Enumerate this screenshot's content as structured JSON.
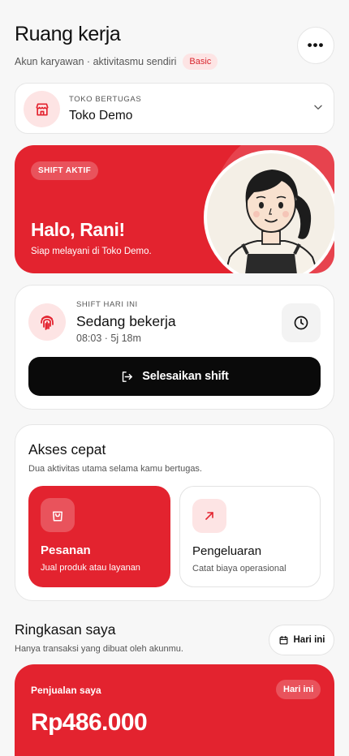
{
  "header": {
    "title": "Ruang kerja",
    "subtitle": "Akun karyawan · aktivitasmu sendiri",
    "badge": "Basic",
    "more_icon": "more-horizontal-icon"
  },
  "store": {
    "kicker": "TOKO BERTUGAS",
    "name": "Toko Demo",
    "icon": "store-icon"
  },
  "hero": {
    "badge": "SHIFT AKTIF",
    "title": "Halo, Rani!",
    "subtitle": "Siap melayani di Toko Demo."
  },
  "shift": {
    "kicker": "SHIFT HARI INI",
    "status": "Sedang bekerja",
    "time": "08:03 · 5j 18m",
    "end_button": "Selesaikan shift"
  },
  "quick_access": {
    "title": "Akses cepat",
    "subtitle": "Dua aktivitas utama selama kamu bertugas.",
    "tiles": [
      {
        "title": "Pesanan",
        "desc": "Jual produk atau layanan",
        "icon": "shopping-bag-icon"
      },
      {
        "title": "Pengeluaran",
        "desc": "Catat biaya operasional",
        "icon": "arrow-up-right-icon"
      }
    ]
  },
  "summary": {
    "title": "Ringkasan saya",
    "subtitle": "Hanya transaksi yang dibuat oleh akunmu.",
    "period_button": "Hari ini",
    "sales_label": "Penjualan saya",
    "sales_chip": "Hari ini",
    "sales_value": "Rp486.000"
  },
  "colors": {
    "accent": "#e3232f",
    "accent_soft": "#fde4e4",
    "background": "#f7f7f7",
    "button_dark": "#0a0a0a"
  }
}
